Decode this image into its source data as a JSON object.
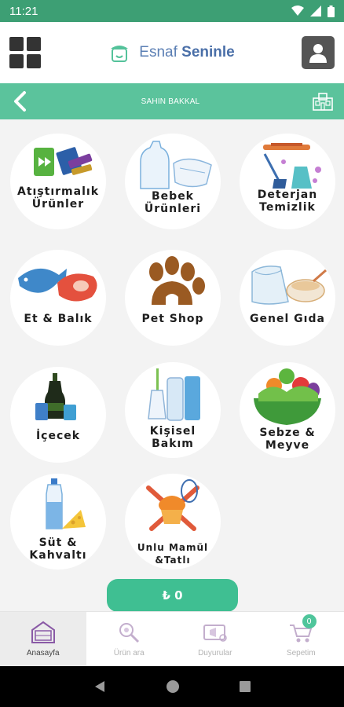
{
  "status_bar": {
    "time": "11:21"
  },
  "header": {
    "brand_regular": "Esnaf ",
    "brand_bold": "Seninle"
  },
  "store": {
    "title": "SAHIN BAKKAL"
  },
  "categories": [
    {
      "line1": "Atıştırmalık",
      "line2": "Ürünler"
    },
    {
      "line1": "Bebek",
      "line2": "Ürünleri"
    },
    {
      "line1": "Deterjan",
      "line2": "Temizlik"
    },
    {
      "line1": "Et & Balık"
    },
    {
      "line1": "Pet Shop"
    },
    {
      "line1": "Genel Gıda"
    },
    {
      "line1": "İçecek"
    },
    {
      "line1": "Kişisel",
      "line2": "Bakım"
    },
    {
      "line1": "Sebze &",
      "line2": "Meyve"
    },
    {
      "line1": "Süt &",
      "line2": "Kahvaltı"
    },
    {
      "line1": "Unlu Mamül",
      "line2": "&Tatlı"
    }
  ],
  "cart": {
    "total": "₺ 0"
  },
  "bottom_nav": {
    "items": [
      {
        "label": "Anasayfa",
        "icon": "home-icon"
      },
      {
        "label": "Ürün ara",
        "icon": "product-search-icon"
      },
      {
        "label": "Duyurular",
        "icon": "announcement-icon"
      },
      {
        "label": "Sepetim",
        "icon": "cart-icon"
      }
    ],
    "cart_badge": "0"
  },
  "colors": {
    "status_bar": "#3d9f74",
    "accent": "#5bc39c",
    "cart_button": "#3fbf92"
  }
}
